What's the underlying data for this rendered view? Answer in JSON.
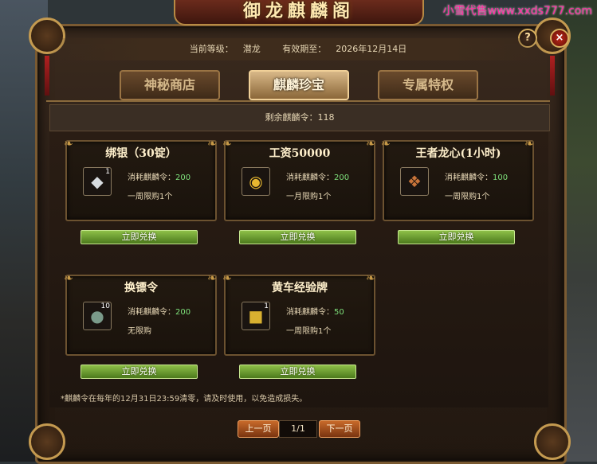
{
  "window": {
    "title": "御龙麒麟阁"
  },
  "watermark": "小雪代售www.xxds777.com",
  "header": {
    "level_label": "当前等级：",
    "level_value": "潜龙",
    "expiry_label": "有效期至：",
    "expiry_value": "2026年12月14日"
  },
  "buttons": {
    "help": "?",
    "close": "×"
  },
  "tabs": [
    {
      "label": "神秘商店",
      "active": false
    },
    {
      "label": "麒麟珍宝",
      "active": true
    },
    {
      "label": "专属特权",
      "active": false
    }
  ],
  "remaining": {
    "label": "剩余麒麟令：",
    "value": "118"
  },
  "items": [
    {
      "name": "绑银（30锭）",
      "icon": "silver-ingot-icon",
      "glyph": "◆",
      "qty": "1",
      "cost_label": "消耗麒麟令：",
      "cost": "200",
      "limit": "一周限购1个",
      "redeem": "立即兑换"
    },
    {
      "name": "工资50000",
      "icon": "gold-coins-icon",
      "glyph": "◉",
      "qty": "",
      "cost_label": "消耗麒麟令：",
      "cost": "200",
      "limit": "一月限购1个",
      "redeem": "立即兑换"
    },
    {
      "name": "王者龙心(1小时)",
      "icon": "dragon-heart-icon",
      "glyph": "❖",
      "qty": "",
      "cost_label": "消耗麒麟令：",
      "cost": "100",
      "limit": "一周限购1个",
      "redeem": "立即兑换"
    },
    {
      "name": "换镖令",
      "icon": "escort-token-icon",
      "glyph": "●",
      "qty": "10",
      "cost_label": "消耗麒麟令：",
      "cost": "200",
      "limit": "无限购",
      "redeem": "立即兑换"
    },
    {
      "name": "黄车经验牌",
      "icon": "yellow-cart-exp-icon",
      "glyph": "■",
      "qty": "1",
      "cost_label": "消耗麒麟令：",
      "cost": "50",
      "limit": "一周限购1个",
      "redeem": "立即兑换"
    }
  ],
  "footnote": "*麒麟令在每年的12月31日23:59清零，请及时使用，以免造成损失。",
  "pager": {
    "prev": "上一页",
    "page": "1/1",
    "next": "下一页"
  }
}
